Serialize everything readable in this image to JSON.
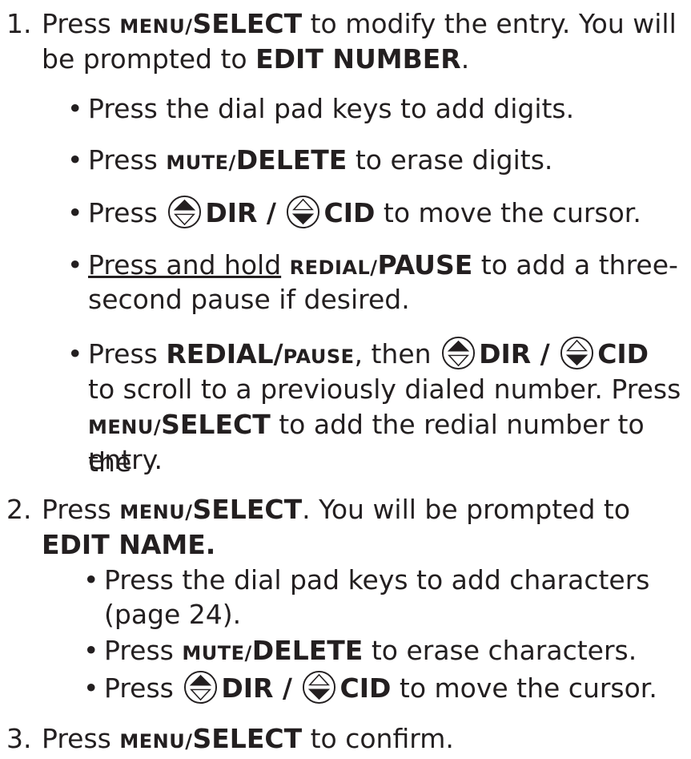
{
  "step1": {
    "number": "1.",
    "press": "Press",
    "menu": "MENU/",
    "select": "SELECT",
    "rest1": "to modify the entry. You will",
    "line2_pre": "be prompted to",
    "edit_number": "EDIT NUMBER",
    "period": ".",
    "bullets": {
      "b1": "Press the dial pad keys to add digits.",
      "b2_press": "Press",
      "b2_mute": "MUTE/",
      "b2_delete": "DELETE",
      "b2_rest": "to erase digits.",
      "b3_press": "Press",
      "b3_dir": "DIR /",
      "b3_cid": "CID",
      "b3_rest": "to move the cursor.",
      "b4_hold": "Press and hold",
      "b4_redial": "REDIAL/",
      "b4_pause": "PAUSE",
      "b4_rest1": "to add a three-",
      "b4_rest2": "second pause if desired.",
      "b5_press": "Press",
      "b5_redial": "REDIAL/",
      "b5_pause": "PAUSE",
      "b5_then": ", then",
      "b5_dir": "DIR /",
      "b5_cid": "CID",
      "b5_line2": "to scroll to a previously dialed number. Press",
      "b5_menu": "MENU/",
      "b5_select": "SELECT",
      "b5_line3_rest": "to add the redial number to the",
      "b5_line4": "entry."
    }
  },
  "step2": {
    "number": "2.",
    "press": "Press",
    "menu": "MENU/",
    "select": "SELECT",
    "rest1": ". You will be prompted to",
    "edit_name": "EDIT NAME.",
    "bullets": {
      "b1_line1": "Press the dial pad keys to add characters",
      "b1_line2": "(page 24).",
      "b2_press": "Press",
      "b2_mute": "MUTE/",
      "b2_delete": "DELETE",
      "b2_rest": "to erase characters.",
      "b3_press": "Press",
      "b3_dir": "DIR /",
      "b3_cid": "CID",
      "b3_rest": "to move the cursor."
    }
  },
  "step3": {
    "number": "3.",
    "press": "Press",
    "menu": "MENU/",
    "select": "SELECT",
    "rest": "to confirm."
  },
  "bullet_glyph": "•"
}
